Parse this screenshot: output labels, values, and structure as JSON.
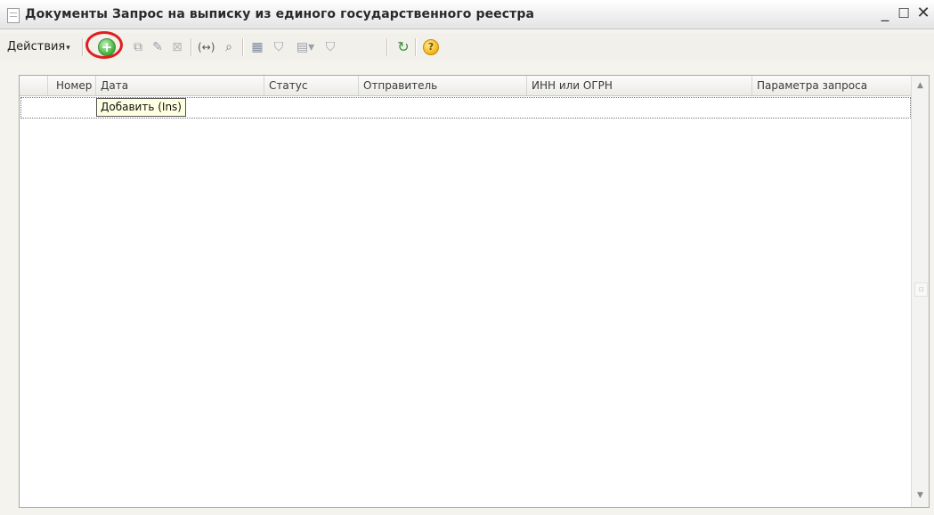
{
  "window": {
    "title": "Документы Запрос на выписку из единого государственного реестра",
    "minimize": "_",
    "maximize": "☐",
    "close": "✕"
  },
  "toolbar": {
    "actions_label": "Действия",
    "actions_caret": "▾",
    "icons": [
      "add-icon",
      "copy-icon",
      "edit-icon",
      "delete-icon",
      "hierarchy-toggle-icon",
      "search-icon",
      "filter-settings-icon",
      "filter-icon",
      "filter-list-icon",
      "clear-filter-icon",
      "refresh-icon",
      "help-icon"
    ],
    "add_symbol": "+",
    "help_symbol": "?",
    "accent_color": "#4fb646",
    "highlight_color": "#e01f1f"
  },
  "table": {
    "columns": [
      "Номер",
      "Дата",
      "Статус",
      "Отправитель",
      "ИНН или ОГРН",
      "Параметра запроса"
    ],
    "tooltip": "Добавить (Ins)",
    "rows": []
  },
  "scrollbar": {
    "up": "▲",
    "down": "▼",
    "thumb": "▫"
  }
}
